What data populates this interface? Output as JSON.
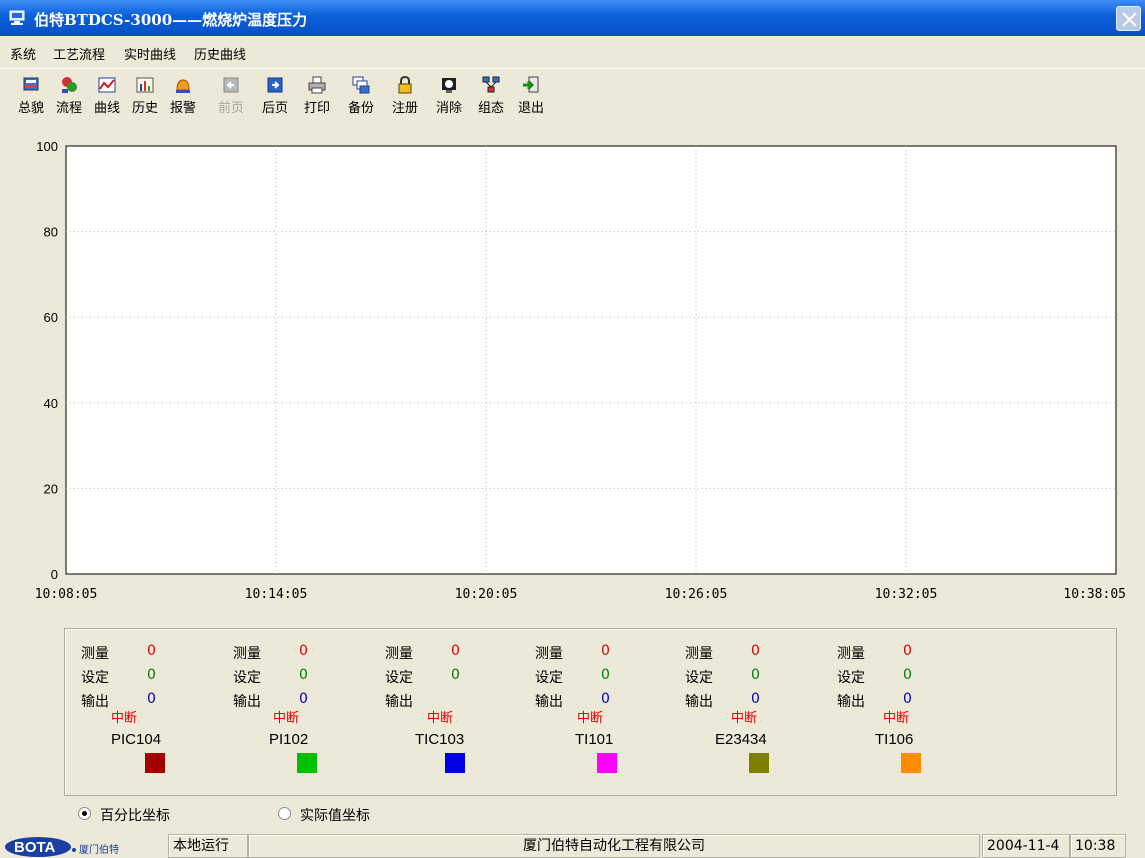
{
  "window": {
    "title": "伯特BTDCS-3000——燃烧炉温度压力",
    "accent": "#0a5fd9"
  },
  "menu": [
    "系统",
    "工艺流程",
    "实时曲线",
    "历史曲线"
  ],
  "toolbar": [
    {
      "label": "总貌",
      "icon": "overview-icon",
      "disabled": false
    },
    {
      "label": "流程",
      "icon": "process-icon",
      "disabled": false
    },
    {
      "label": "曲线",
      "icon": "trend-icon",
      "disabled": false
    },
    {
      "label": "历史",
      "icon": "history-icon",
      "disabled": false
    },
    {
      "label": "报警",
      "icon": "alarm-icon",
      "disabled": false
    },
    {
      "label": "前页",
      "icon": "prev-page-icon",
      "disabled": true
    },
    {
      "label": "后页",
      "icon": "next-page-icon",
      "disabled": false
    },
    {
      "label": "打印",
      "icon": "printer-icon",
      "disabled": false
    },
    {
      "label": "备份",
      "icon": "backup-icon",
      "disabled": false
    },
    {
      "label": "注册",
      "icon": "lock-icon",
      "disabled": false
    },
    {
      "label": "消除",
      "icon": "clear-icon",
      "disabled": false
    },
    {
      "label": "组态",
      "icon": "configure-icon",
      "disabled": false
    },
    {
      "label": "退出",
      "icon": "exit-icon",
      "disabled": false
    }
  ],
  "chart_data": {
    "type": "line",
    "title": "",
    "xlabel": "",
    "ylabel": "",
    "ylim": [
      0,
      100
    ],
    "yticks": [
      0,
      20,
      40,
      60,
      80,
      100
    ],
    "xticks": [
      "10:08:05",
      "10:14:05",
      "10:20:05",
      "10:26:05",
      "10:32:05",
      "10:38:05"
    ],
    "grid": true,
    "series": []
  },
  "legend": {
    "labels": {
      "measure": "测量",
      "setpoint": "设定",
      "output": "输出"
    },
    "items": [
      {
        "tag": "PIC104",
        "measure": "0",
        "setpoint": "0",
        "output": "0",
        "status": "中断",
        "color": "#a50000"
      },
      {
        "tag": "PI102",
        "measure": "0",
        "setpoint": "0",
        "output": "0",
        "status": "中断",
        "color": "#00c000"
      },
      {
        "tag": "TIC103",
        "measure": "0",
        "setpoint": "0",
        "output": "",
        "status": "中断",
        "color": "#0000e0"
      },
      {
        "tag": "TI101",
        "measure": "0",
        "setpoint": "0",
        "output": "0",
        "status": "中断",
        "color": "#ff00ff"
      },
      {
        "tag": "E23434",
        "measure": "0",
        "setpoint": "0",
        "output": "0",
        "status": "中断",
        "color": "#808000"
      },
      {
        "tag": "TI106",
        "measure": "0",
        "setpoint": "0",
        "output": "0",
        "status": "中断",
        "color": "#ff8c00"
      }
    ],
    "value_colors": {
      "measure": "#e00000",
      "setpoint": "#008000",
      "output": "#0000c0"
    }
  },
  "axis_mode": {
    "options": [
      "百分比坐标",
      "实际值坐标"
    ],
    "selected": "百分比坐标"
  },
  "statusbar": {
    "logo_text": "BOTA",
    "logo_sub": "厦门伯特",
    "mode": "本地运行",
    "company": "厦门伯特自动化工程有限公司",
    "date": "2004-11-4",
    "time": "10:38"
  }
}
